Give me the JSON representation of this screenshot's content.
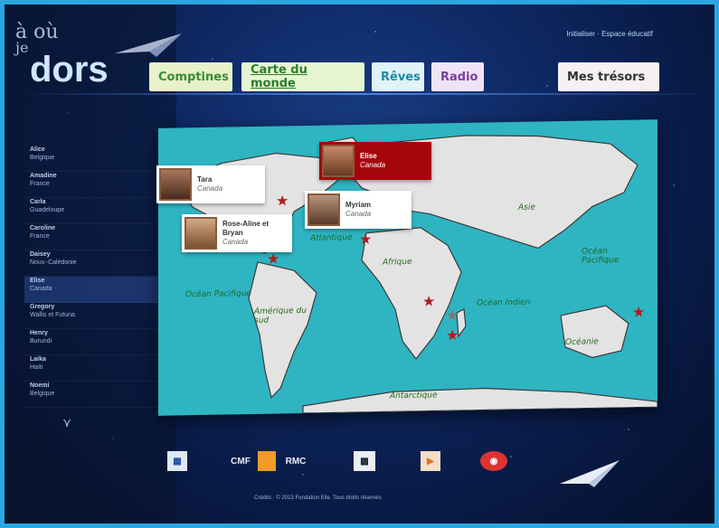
{
  "logo": {
    "line1": "à où",
    "line2": "je",
    "line3": "dors"
  },
  "top_right": "Initialiser · Espace éducatif",
  "tabs": {
    "comptines": "Comptines",
    "carte": "Carte du monde",
    "reves": "Rêves",
    "radio": "Radio",
    "tresors": "Mes trésors"
  },
  "sidebar": {
    "items": [
      {
        "name": "Alice",
        "place": "Belgique"
      },
      {
        "name": "Amadine",
        "place": "France"
      },
      {
        "name": "Carla",
        "place": "Guadeloupe"
      },
      {
        "name": "Caroline",
        "place": "France"
      },
      {
        "name": "Daisey",
        "place": "Nouv.-Calédonie"
      },
      {
        "name": "Elise",
        "place": "Canada"
      },
      {
        "name": "Gregory",
        "place": "Wallis et Futuna"
      },
      {
        "name": "Henry",
        "place": "Burundi"
      },
      {
        "name": "Laika",
        "place": "Haïti"
      },
      {
        "name": "Noemi",
        "place": "Belgique"
      }
    ],
    "more_icon": "chevron-double-down-icon"
  },
  "map": {
    "oceans": {
      "pac_left": "Océan Pacifique",
      "atlantique": "Atlantique",
      "indien": "Océan Indien",
      "pac_right": "Océan Pacifique"
    },
    "continents": {
      "asie": "Asie",
      "afrique": "Afrique",
      "am_sud": "Amérique du sud",
      "oceanie": "Océanie",
      "antarctique": "Antarctique"
    }
  },
  "cards": [
    {
      "name": "Elise",
      "place": "Canada"
    },
    {
      "name": "Tara",
      "place": "Canada"
    },
    {
      "name": "Myriam",
      "place": "Canada"
    },
    {
      "name": "Rose-Aline et Bryan",
      "place": "Canada"
    }
  ],
  "bottom": {
    "logo_cmf": "CMF",
    "logo_rmc": "RMC",
    "credits": "Crédits · © 2013 Fondation Elle. Tous droits réservés"
  },
  "colors": {
    "accent": "#2aa7e0",
    "selected_card": "#a5050c",
    "map_water": "#2fb4c2"
  }
}
